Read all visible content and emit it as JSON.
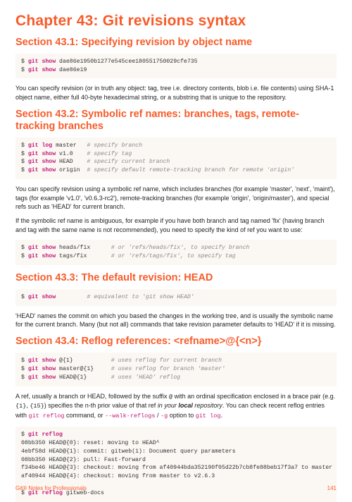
{
  "chapter": {
    "title": "Chapter 43: Git revisions syntax"
  },
  "s1": {
    "title": "Section 43.1: Specifying revision by object name",
    "code_l1_prompt": "$ ",
    "code_l1_kw": "git show",
    "code_l1_rest": " dae86e1950b1277e545cee180551750029cfe735",
    "code_l2_prompt": "$ ",
    "code_l2_kw": "git show",
    "code_l2_rest": " dae86e19",
    "p1": "You can specify revision (or in truth any object: tag, tree i.e. directory contents, blob i.e. file contents) using SHA-1 object name, either full 40-byte hexadecimal string, or a substring that is unique to the repository."
  },
  "s2": {
    "title": "Section 43.2: Symbolic ref names: branches, tags, remote-tracking branches",
    "c1_l1_p": "$ ",
    "c1_l1_kw": "git log",
    "c1_l1_a": " master   ",
    "c1_l1_c": "# specify branch",
    "c1_l2_p": "$ ",
    "c1_l2_kw": "git show",
    "c1_l2_a": " v1.0    ",
    "c1_l2_c": "# specify tag",
    "c1_l3_p": "$ ",
    "c1_l3_kw": "git show",
    "c1_l3_a": " HEAD    ",
    "c1_l3_c": "# specify current branch",
    "c1_l4_p": "$ ",
    "c1_l4_kw": "git show",
    "c1_l4_a": " origin  ",
    "c1_l4_c": "# specify default remote-tracking branch for remote 'origin'",
    "p1": "You can specify revision using a symbolic ref name, which includes branches (for example 'master', 'next', 'maint'), tags (for example 'v1.0', 'v0.6.3-rc2'), remote-tracking branches (for example 'origin', 'origin/master'), and special refs such as 'HEAD' for current branch.",
    "p2": "If the symbolic ref name is ambiguous, for example if you have both branch and tag named 'fix' (having branch and tag with the same name is not recommended), you need to specify the kind of ref you want to use:",
    "c2_l1_p": "$ ",
    "c2_l1_kw": "git show",
    "c2_l1_a": " heads/fix      ",
    "c2_l1_c": "# or 'refs/heads/fix', to specify branch",
    "c2_l2_p": "$ ",
    "c2_l2_kw": "git show",
    "c2_l2_a": " tags/fix       ",
    "c2_l2_c": "# or 'refs/tags/fix', to specify tag"
  },
  "s3": {
    "title": "Section 43.3: The default revision: HEAD",
    "c1_p": "$ ",
    "c1_kw": "git show",
    "c1_pad": "         ",
    "c1_c": "# equivalent to 'git show HEAD'",
    "p1": "'HEAD' names the commit on which you based the changes in the working tree, and is usually the symbolic name for the current branch. Many (but not all) commands that take revision parameter defaults to 'HEAD' if it is missing."
  },
  "s4": {
    "title": "Section 43.4: Reflog references: <refname>@{<n>}",
    "c1_l1_p": "$ ",
    "c1_l1_kw": "git show",
    "c1_l1_a": " @{1}           ",
    "c1_l1_c": "# uses reflog for current branch",
    "c1_l2_p": "$ ",
    "c1_l2_kw": "git show",
    "c1_l2_a": " master@{1}     ",
    "c1_l2_c": "# uses reflog for branch 'master'",
    "c1_l3_p": "$ ",
    "c1_l3_kw": "git show",
    "c1_l3_a": " HEAD@{1}       ",
    "c1_l3_c": "# uses 'HEAD' reflog",
    "p1a": "A ref, usually a branch or HEAD, followed by the suffix ",
    "p1_at": "@",
    "p1b": " with an ordinal specification enclosed in a brace pair (e.g. ",
    "p1_b1": "{1}",
    "p1c": ", ",
    "p1_b2": "{15}",
    "p1d": ") specifies the n-th prior value of that ref ",
    "p1_em": "in your ",
    "p1_strong": "local",
    "p1_em2": " repository",
    "p1e": ". You can check recent reflog entries with ",
    "p1_cmd1": "git reflog",
    "p1f": " command, or ",
    "p1_cmd2": "--walk-reflogs",
    "p1g": " / ",
    "p1_cmd3": "-g",
    "p1h": " option to ",
    "p1_cmd4": "git log",
    "p1i": ".",
    "c2_l1_p": "$ ",
    "c2_l1_kw": "git reflog",
    "c2_l2": "08bb350 HEAD@{0}: reset: moving to HEAD^",
    "c2_l3": "4ebf58d HEAD@{1}: commit: gitweb(1): Document query parameters",
    "c2_l4": "08bb350 HEAD@{2}: pull: Fast-forward",
    "c2_l5": "f34be46 HEAD@{3}: checkout: moving from af40944bda352190f05d22b7cb8fe88beb17f3a7 to master",
    "c2_l6": "af40944 HEAD@{4}: checkout: moving from master to v2.6.3",
    "c2_l8_p": "$ ",
    "c2_l8_kw": "git reflog",
    "c2_l8_a": " gitweb-docs"
  },
  "footer": {
    "left": "Git® Notes for Professionals",
    "right": "141"
  }
}
